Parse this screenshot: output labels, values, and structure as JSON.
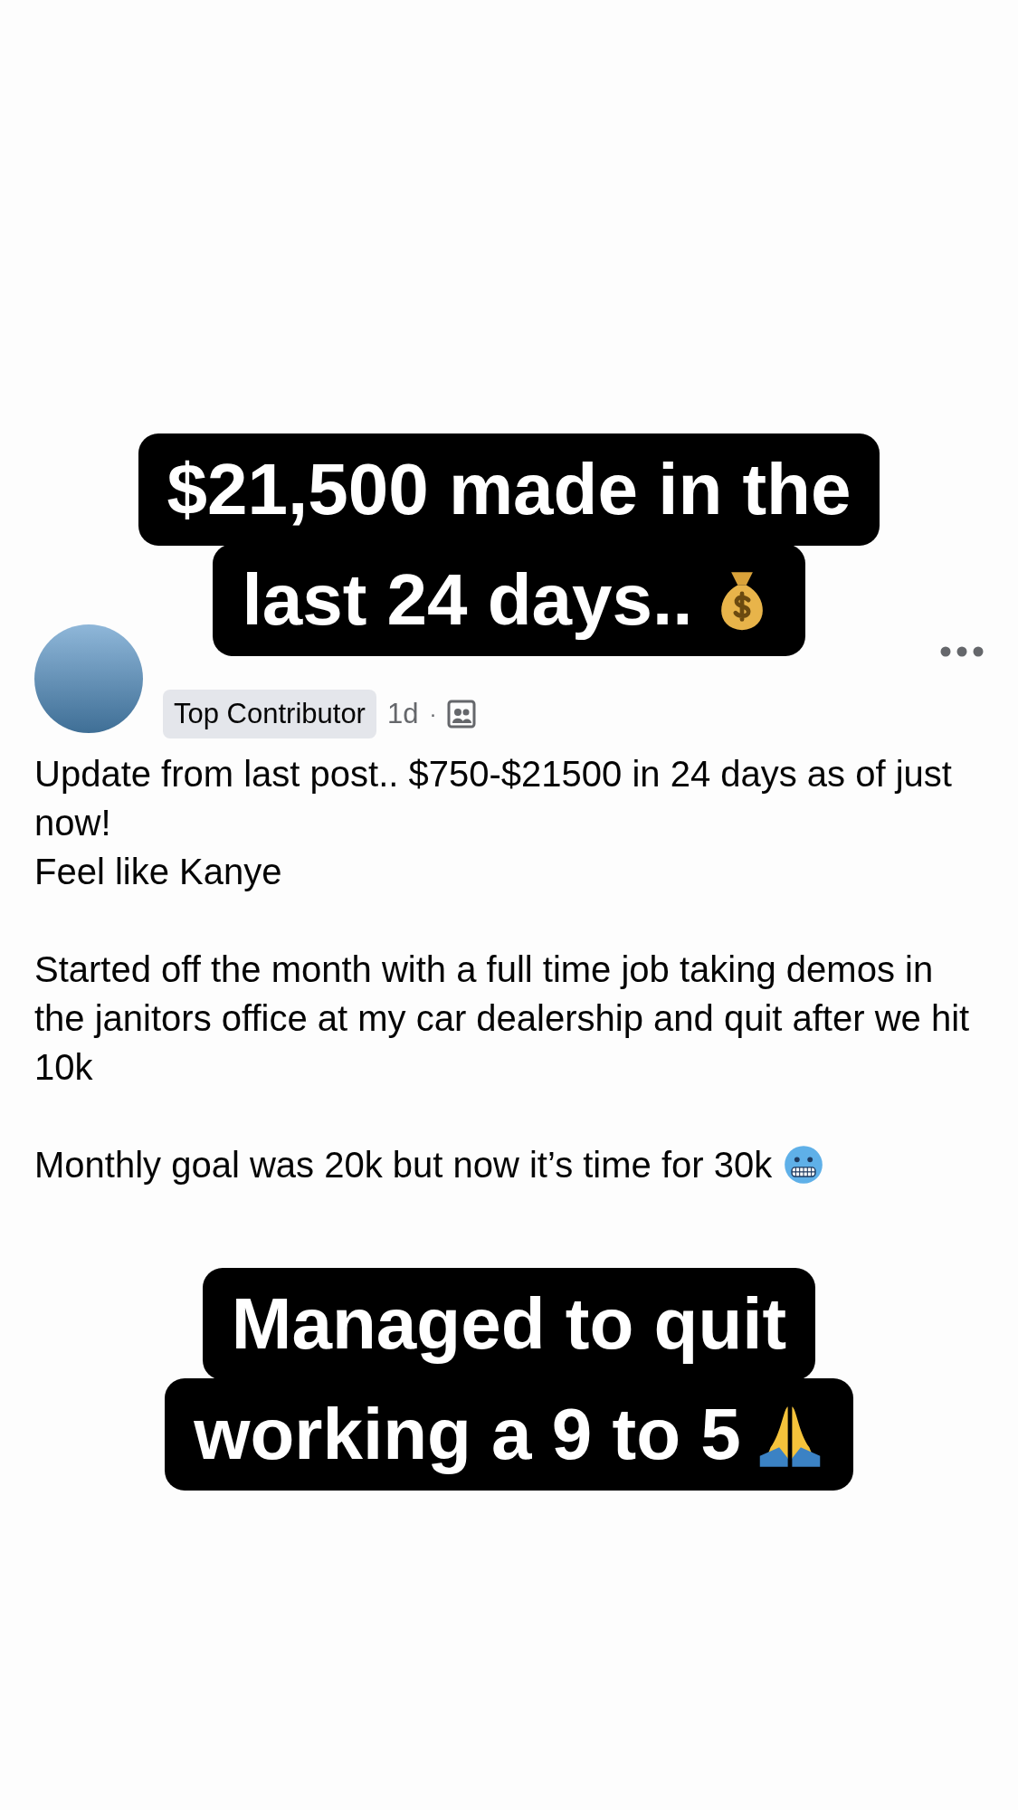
{
  "top_caption": {
    "lines": [
      "$21,500 made in the",
      "last 24 days.."
    ],
    "trailing_icon": {
      "kind": "moneybag"
    }
  },
  "post": {
    "badge": "Top Contributor",
    "time": "1d",
    "separator": "·",
    "paragraphs": [
      {
        "lines": [
          "Update from last post.. $750-$21500 in 24 days as of just now!",
          "Feel like Kanye"
        ]
      },
      {
        "lines": [
          "Started off the month with a full time job taking demos in the janitors office at my car dealership and quit after we hit 10k"
        ]
      },
      {
        "lines": [
          "Monthly goal was 20k but now it’s time for 30k"
        ],
        "trailing_icon": {
          "kind": "coldface"
        }
      }
    ]
  },
  "bottom_caption": {
    "lines": [
      "Managed to quit",
      "working a 9 to 5"
    ],
    "trailing_icon": {
      "kind": "prayinghands"
    }
  }
}
